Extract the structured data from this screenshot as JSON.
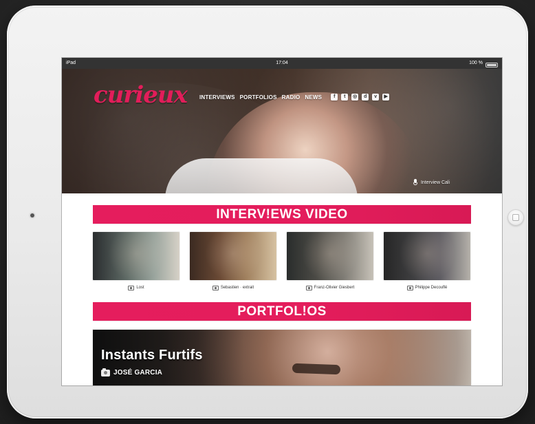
{
  "statusbar": {
    "left": "iPad",
    "time": "17:04",
    "battery": "100 %"
  },
  "site": {
    "brand": "curieux",
    "nav": [
      "INTERVIEWS",
      "PORTFOLIOS",
      "RADIO",
      "NEWS"
    ],
    "social_icons": [
      "facebook-icon",
      "twitter-icon",
      "instagram-icon",
      "dailymotion-icon",
      "vimeo-icon",
      "youtube-icon"
    ],
    "hero_caption": "Interview Cali"
  },
  "sections": {
    "interviews_video": "INTERV!EWS VIDEO",
    "portfolios": "PORTFOL!OS"
  },
  "videos": [
    {
      "caption": "Lost"
    },
    {
      "caption": "Sebastien · extrait"
    },
    {
      "caption": "Franz-Olivier Giesbert"
    },
    {
      "caption": "Philippe Decouflé"
    }
  ],
  "portfolio": {
    "title": "Instants Furtifs",
    "subtitle": "JOSÉ GARCIA"
  },
  "colors": {
    "accent": "#E51D5D",
    "tablet": "#ECECEC",
    "background": "#2B2B2B"
  }
}
